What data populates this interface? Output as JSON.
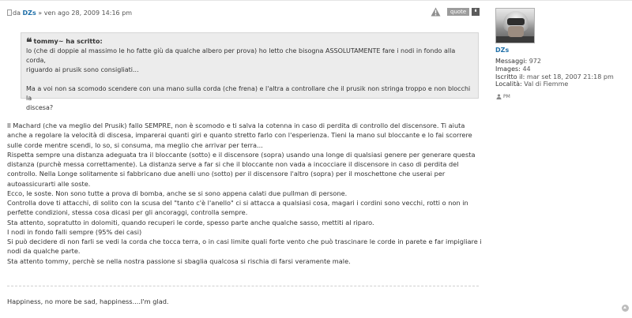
{
  "post": {
    "author_prefix": "da",
    "author_name": "DZs",
    "date_sep": "»",
    "date": "ven ago 28, 2009 14:16 pm",
    "quote_button_label": "quote",
    "quote_icon_glyph": "❛"
  },
  "blockquote": {
    "cite": "tommy~ ha scritto:",
    "lines": [
      "lo (che di doppie al massimo le ho fatte giù da qualche albero per prova) ho letto che bisogna ASSOLUTAMENTE fare i nodi in fondo alla corda,",
      "riguardo ai prusik sono consigliati..."
    ],
    "lines2": [
      "Ma a voi non sa scomodo scendere con una mano sulla corda (che frena) e l'altra a controllare che il prusik non stringa troppo e non blocchi la",
      "discesa?"
    ]
  },
  "content_lines": [
    "Il Machard (che va meglio del Prusik) fallo SEMPRE, non è scomodo e ti salva la cotenna in caso di perdita di controllo del discensore. Ti aiuta",
    "anche a regolare la velocità di discesa, imparerai quanti giri e quanto stretto farlo con l'esperienza. Tieni la mano sul bloccante e lo fai scorrere",
    "sulle corde mentre scendi, lo so, si consuma, ma meglio che arrivar per terra...",
    "Rispetta sempre una distanza adeguata tra il bloccante (sotto) e il discensore (sopra) usando una longe di qualsiasi genere per generare questa",
    "distanza (purchè messa correttamente). La distanza serve a far si che il bloccante non vada a incocciare il discensore in caso di perdita del",
    "controllo. Nella Longe solitamente si fabbricano due anelli uno (sotto) per il discensore l'altro (sopra) per il moschettone che userai per",
    "autoassicurarti alle soste.",
    "Ecco, le soste. Non sono tutte a prova di bomba, anche se si sono appena calati due pullman di persone.",
    "Controlla dove ti attacchi, di solito con la scusa del \"tanto c'è l'anello\" ci si attacca a qualsiasi cosa, magari i cordini sono vecchi, rotti o non in",
    "perfette condizioni, stessa cosa dicasi per gli ancoraggi, controlla sempre.",
    "Sta attento, sopratutto in dolomiti, quando recuperi le corde, spesso parte anche qualche sasso, mettiti al riparo.",
    "I nodi in fondo falli sempre (95% dei casi)",
    "Si può decidere di non farli se vedi la corda che tocca terra, o in casi limite quali forte vento che può trascinare le corde in parete e far impigliare i",
    "nodi da qualche parte.",
    "Sta attento tommy, perchè se nella nostra passione si sbaglia qualcosa si rischia di farsi veramente male."
  ],
  "signature": "Happiness, no more be sad, happiness....I'm glad.",
  "profile": {
    "username": "DZs",
    "messages_label": "Messaggi:",
    "messages_value": "972",
    "images_label": "Images:",
    "images_value": "44",
    "joined_label": "Iscritto il:",
    "joined_value": "mar set 18, 2007 21:18 pm",
    "location_label": "Località:",
    "location_value": "Val di Fiemme",
    "pm_label": "PM"
  },
  "colors": {
    "link": "#1f6fa8",
    "quote_bg": "#ececec",
    "quote_button": "#9c9c9c"
  },
  "icons": [
    "post-icon",
    "report-icon",
    "quote-icon",
    "pm-icon",
    "back-to-top-icon"
  ]
}
